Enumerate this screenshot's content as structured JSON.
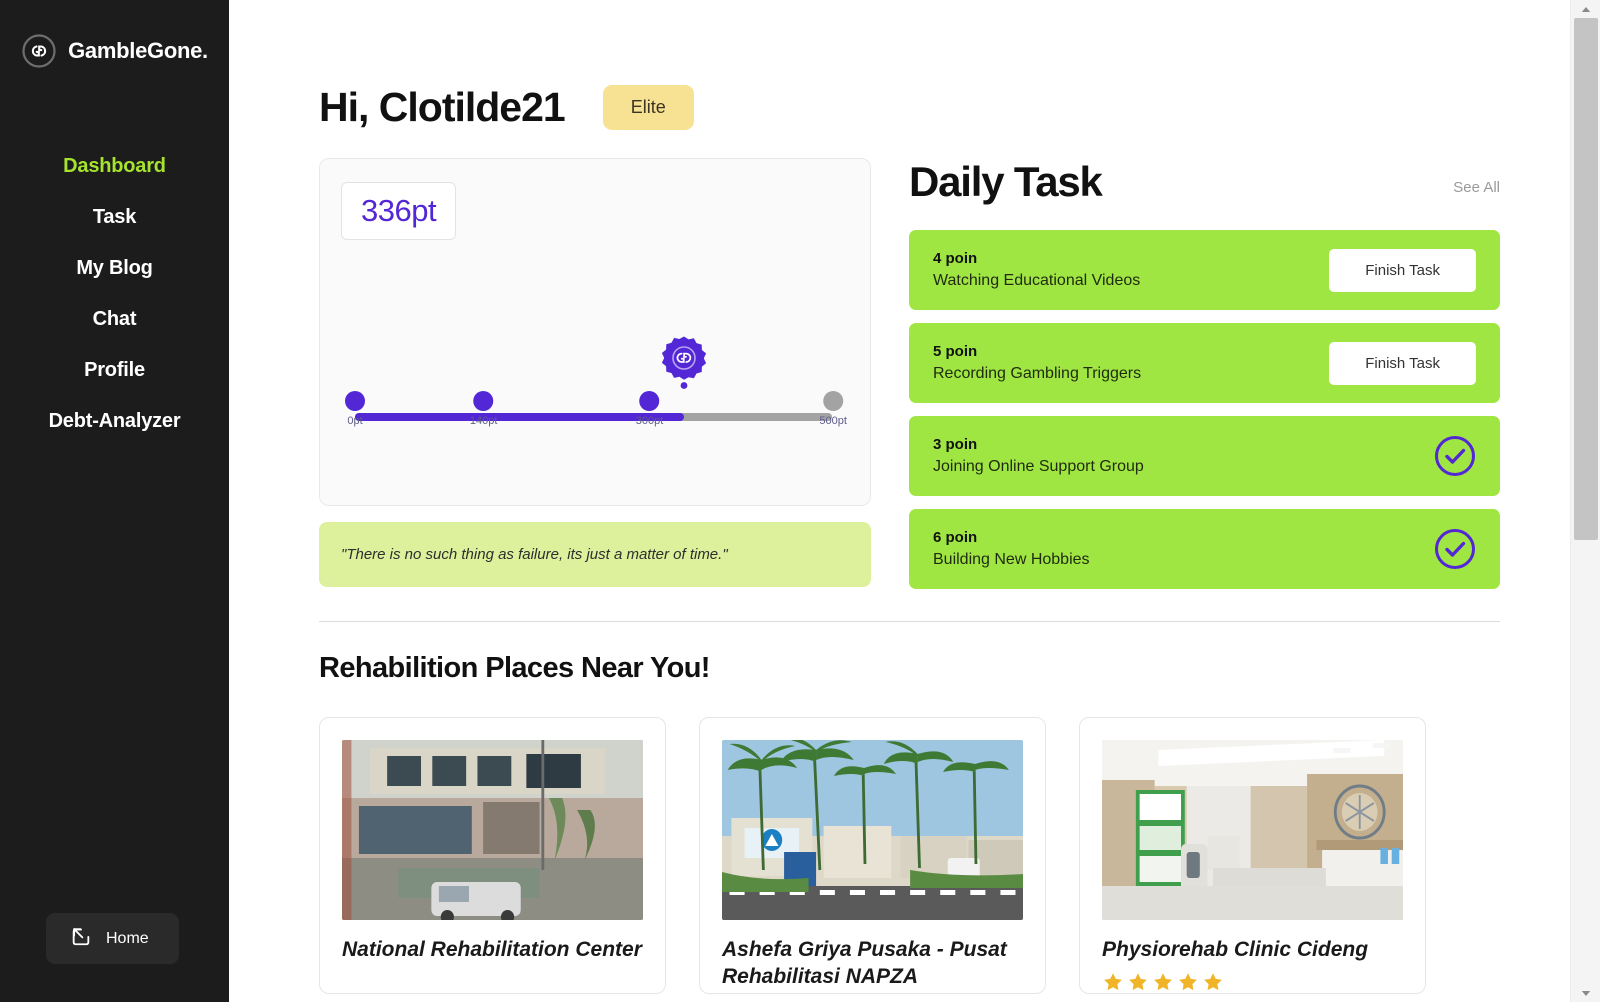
{
  "sidebar": {
    "brand": {
      "text": "GambleGone.",
      "logo_icon": "gamblegone-logo-icon"
    },
    "items": [
      {
        "label": "Dashboard",
        "active": true
      },
      {
        "label": "Task",
        "active": false
      },
      {
        "label": "My Blog",
        "active": false
      },
      {
        "label": "Chat",
        "active": false
      },
      {
        "label": "Profile",
        "active": false
      },
      {
        "label": "Debt-Analyzer",
        "active": false
      }
    ],
    "home": {
      "label": "Home",
      "icon": "arrow-out-of-box-icon"
    },
    "colors": {
      "bg": "#1c1c1c",
      "active": "#a5e32e",
      "home_bg": "#2a2a2a"
    }
  },
  "header": {
    "greeting": "Hi, Clotilde21",
    "badge": "Elite",
    "badge_color": "#f7e193"
  },
  "points": {
    "current": "336pt",
    "accent": "#5326d6",
    "gear_icon": "gear-logo-badge-icon",
    "marker_position_percent": 66.5,
    "stops": [
      {
        "label": "0pt",
        "pos": 0,
        "filled": true
      },
      {
        "label": "140pt",
        "pos": 26,
        "filled": true
      },
      {
        "label": "300pt",
        "pos": 59.5,
        "filled": true
      },
      {
        "label": "500pt",
        "pos": 100,
        "filled": false
      }
    ]
  },
  "quote": {
    "text": "\"There is no such thing as failure, its just a matter of time.\"",
    "bg": "#ddf09c"
  },
  "daily_task": {
    "title": "Daily Task",
    "see_all": "See All",
    "card_bg": "#a0e642",
    "items": [
      {
        "points": "4 poin",
        "name": "Watching Educational Videos",
        "action": "Finish Task",
        "done": false
      },
      {
        "points": "5 poin",
        "name": "Recording Gambling Triggers",
        "action": "Finish Task",
        "done": false
      },
      {
        "points": "3 poin",
        "name": "Joining Online Support Group",
        "action": "",
        "done": true
      },
      {
        "points": "6 poin",
        "name": "Building New Hobbies",
        "action": "",
        "done": true
      }
    ],
    "done_icon": "check-circle-icon"
  },
  "rehab": {
    "title": "Rehabilition Places Near You!",
    "places": [
      {
        "name": "National Rehabilitation Center",
        "photo": "rehab-building-exterior-photo",
        "stars": 0
      },
      {
        "name": "Ashefa Griya Pusaka - Pusat Rehabilitasi NAPZA",
        "photo": "rehab-palm-entrance-photo",
        "stars": 0
      },
      {
        "name": "Physiorehab Clinic Cideng",
        "photo": "clinic-lobby-interior-photo",
        "stars": 5
      }
    ],
    "star_color": "#f0b429"
  },
  "scrollbar": {
    "up_icon": "scroll-up-arrow-icon",
    "down_icon": "scroll-down-arrow-icon"
  }
}
